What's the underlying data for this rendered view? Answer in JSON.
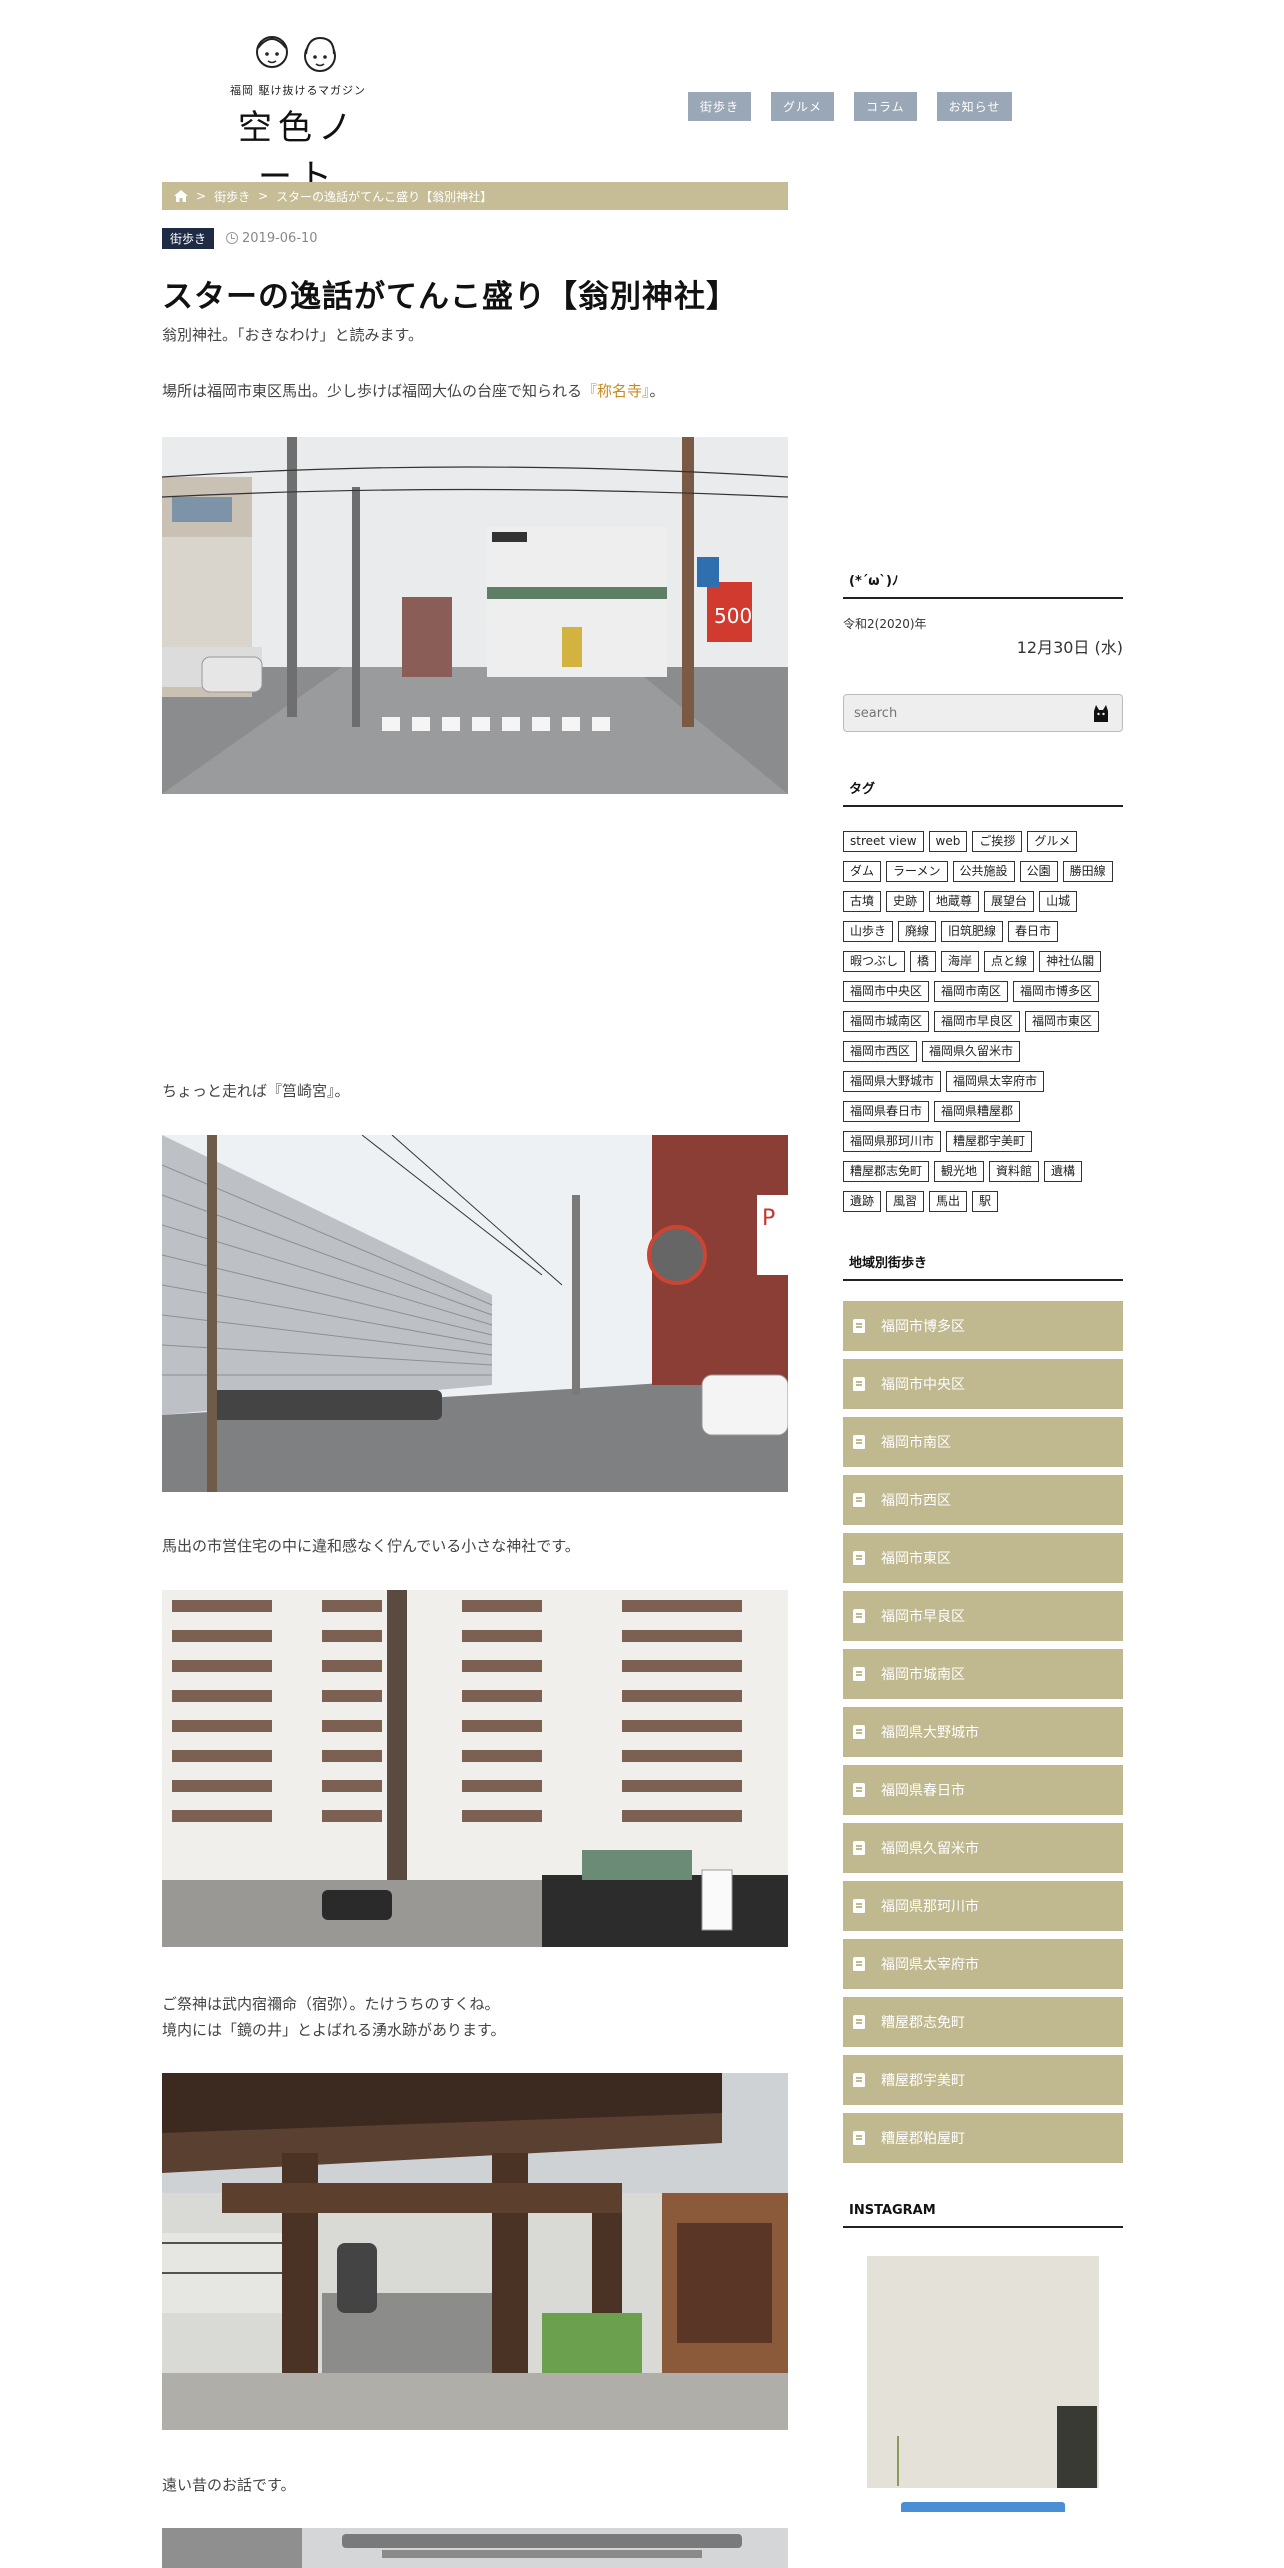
{
  "site": {
    "tagline": "福岡 駆け抜けるマガジン",
    "name": "空色ノート"
  },
  "nav": [
    "街歩き",
    "グルメ",
    "コラム",
    "お知らせ"
  ],
  "breadcrumb": {
    "home_icon": "home-icon",
    "items": [
      "街歩き",
      "スターの逸話がてんこ盛り【翁別神社】"
    ]
  },
  "post": {
    "category": "街歩き",
    "date": "2019-06-10",
    "title": "スターの逸話がてんこ盛り【翁別神社】",
    "p1": "翁別神社。「おきなわけ」と読みます。",
    "p2_pre": "場所は福岡市東区馬出。少し歩けば福岡大仏の台座で知られる",
    "p2_link": "『称名寺』",
    "p2_post": "。",
    "p3": "ちょっと走れば『筥崎宮』。",
    "p4": "馬出の市営住宅の中に違和感なく佇んでいる小さな神社です。",
    "p5a": "ご祭神は武内宿禰命（宿弥）。たけうちのすくね。",
    "p5b": "境内には「鏡の井」とよばれる湧水跡があります。",
    "p6": "遠い昔のお話です。"
  },
  "sidebar": {
    "greeting": "(*´ω`)ﾉ",
    "era_year": "令和2(2020)年",
    "day": "12月30日 (水)",
    "search_placeholder": "search",
    "tags_title": "タグ",
    "tags": [
      "street view",
      "web",
      "ご挨拶",
      "グルメ",
      "ダム",
      "ラーメン",
      "公共施設",
      "公園",
      "勝田線",
      "古墳",
      "史跡",
      "地蔵尊",
      "展望台",
      "山城",
      "山歩き",
      "廃線",
      "旧筑肥線",
      "春日市",
      "暇つぶし",
      "橋",
      "海岸",
      "点と線",
      "神社仏閣",
      "福岡市中央区",
      "福岡市南区",
      "福岡市博多区",
      "福岡市城南区",
      "福岡市早良区",
      "福岡市東区",
      "福岡市西区",
      "福岡県久留米市",
      "福岡県大野城市",
      "福岡県太宰府市",
      "福岡県春日市",
      "福岡県糟屋郡",
      "福岡県那珂川市",
      "糟屋郡宇美町",
      "糟屋郡志免町",
      "観光地",
      "資料館",
      "遺構",
      "遺跡",
      "風習",
      "馬出",
      "駅"
    ],
    "areas_title": "地域別街歩き",
    "areas": [
      "福岡市博多区",
      "福岡市中央区",
      "福岡市南区",
      "福岡市西区",
      "福岡市東区",
      "福岡市早良区",
      "福岡市城南区",
      "福岡県大野城市",
      "福岡県春日市",
      "福岡県久留米市",
      "福岡県那珂川市",
      "福岡県太宰府市",
      "糟屋郡志免町",
      "糟屋郡宇美町",
      "糟屋郡粕屋町"
    ],
    "instagram_title": "INSTAGRAM"
  }
}
